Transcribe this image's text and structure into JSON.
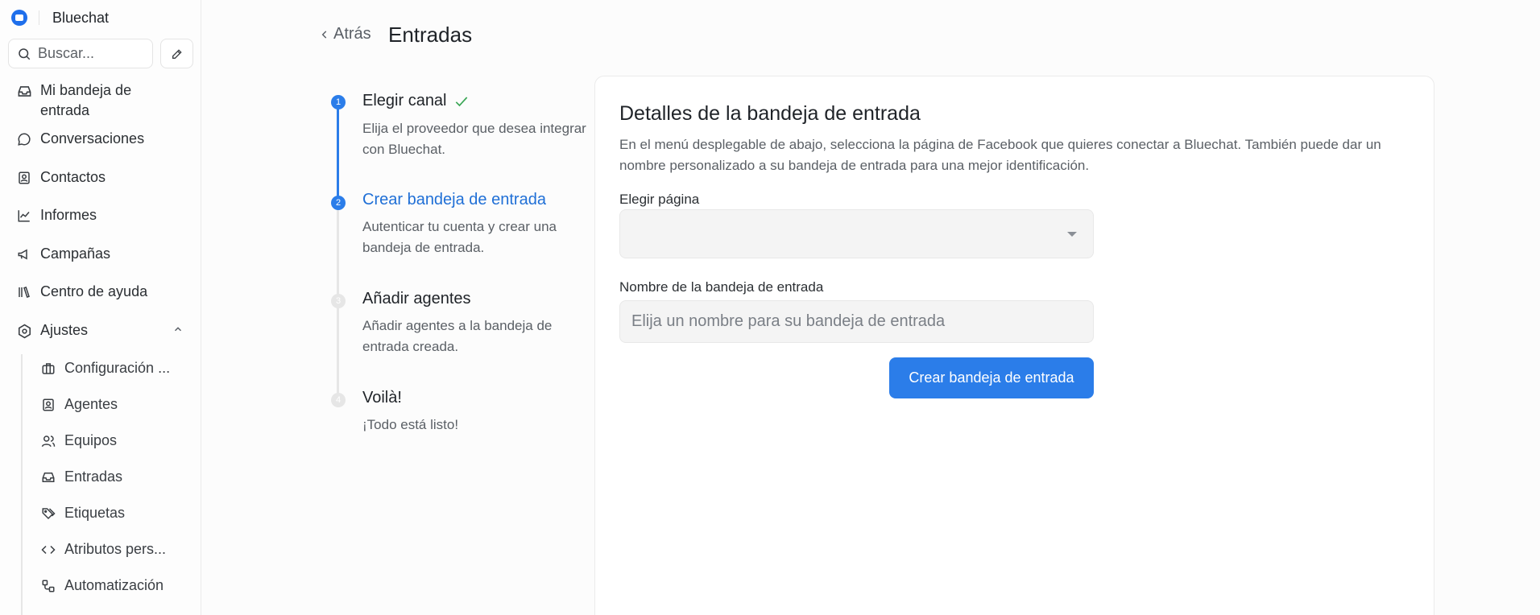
{
  "app": {
    "name": "Bluechat"
  },
  "search": {
    "placeholder": "Buscar..."
  },
  "sidebar": {
    "items": [
      {
        "label": "Mi bandeja de entrada"
      },
      {
        "label": "Conversaciones"
      },
      {
        "label": "Contactos"
      },
      {
        "label": "Informes"
      },
      {
        "label": "Campañas"
      },
      {
        "label": "Centro de ayuda"
      },
      {
        "label": "Ajustes"
      }
    ],
    "settings_items": [
      {
        "label": "Configuración ..."
      },
      {
        "label": "Agentes"
      },
      {
        "label": "Equipos"
      },
      {
        "label": "Entradas"
      },
      {
        "label": "Etiquetas"
      },
      {
        "label": "Atributos pers..."
      },
      {
        "label": "Automatización"
      }
    ]
  },
  "header": {
    "back_label": "Atrás",
    "title": "Entradas"
  },
  "steps": [
    {
      "number": "1",
      "title": "Elegir canal",
      "description": "Elija el proveedor que desea integrar con Bluechat.",
      "status": "done"
    },
    {
      "number": "2",
      "title": "Crear bandeja de entrada",
      "description": "Autenticar tu cuenta y crear una bandeja de entrada.",
      "status": "active"
    },
    {
      "number": "3",
      "title": "Añadir agentes",
      "description": "Añadir agentes a la bandeja de entrada creada.",
      "status": "pending"
    },
    {
      "number": "4",
      "title": "Voilà!",
      "description": "¡Todo está listo!",
      "status": "pending"
    }
  ],
  "form": {
    "title": "Detalles de la bandeja de entrada",
    "description": "En el menú desplegable de abajo, selecciona la página de Facebook que quieres conectar a Bluechat. También puede dar un nombre personalizado a su bandeja de entrada para una mejor identificación.",
    "page_label": "Elegir página",
    "page_value": "",
    "name_label": "Nombre de la bandeja de entrada",
    "name_placeholder": "Elija un nombre para su bandeja de entrada",
    "submit_label": "Crear bandeja de entrada"
  },
  "colors": {
    "accent": "#2b7de9",
    "check": "#3aa655"
  }
}
